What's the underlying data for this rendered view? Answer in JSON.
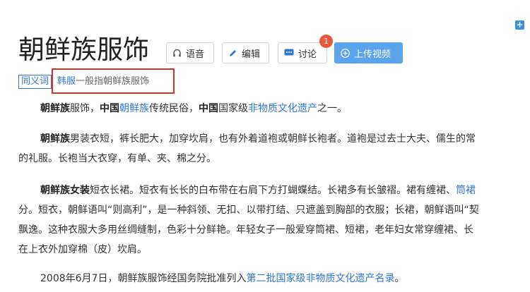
{
  "title": "朝鲜族服饰",
  "actions": {
    "voice": "语音",
    "edit": "编辑",
    "discuss": "讨论",
    "discuss_badge": "1",
    "upload": "上传视频"
  },
  "synonym": {
    "tag": "同义词",
    "link": "韩服",
    "desc": "一般指朝鲜族服饰"
  },
  "p1": {
    "b1": "朝鲜族",
    "t1": "服饰，",
    "b2": "中国",
    "l1": "朝鲜族",
    "t2": "传统民俗，",
    "b3": "中国",
    "t3": "国家级",
    "l2": "非物质文化遗产",
    "t4": "之一。"
  },
  "p2": {
    "b1": "朝鲜族",
    "t1": "男装衣短，裤长肥大，加穿坎肩，也有外着道袍或朝鲜长袍者。道袍是过去士大夫、儒生的常",
    "line2": "的礼服。长袍当大衣穿，有单、夹、棉之分。"
  },
  "p3": {
    "b1": "朝鲜族女装",
    "t1": "短衣长裙。短衣有长长的白布带在右肩下方打蝴蝶结。长裙多有长皱褶。裙有缠裙、",
    "l1": "筒裙",
    "line2": "分。短衣，朝鲜语叫“则高利”，是一种斜领、无扣、以带打结、只遮盖到胸部的衣服；长裙，朝鲜语叫“契",
    "line3": "飘逸。这种衣服大多用丝绸缝制，色彩十分鲜艳。年轻女子一般爱穿筒裙、短裙，老年妇女常穿缠裙、长",
    "line4": "在上衣外加穿棉（皮）坎肩。"
  },
  "p4": {
    "t1": "2008年6月7日，朝鲜族服饰经国务院批准列入",
    "l1": "第二批国家级非物质文化遗产名录",
    "t2": "。"
  }
}
